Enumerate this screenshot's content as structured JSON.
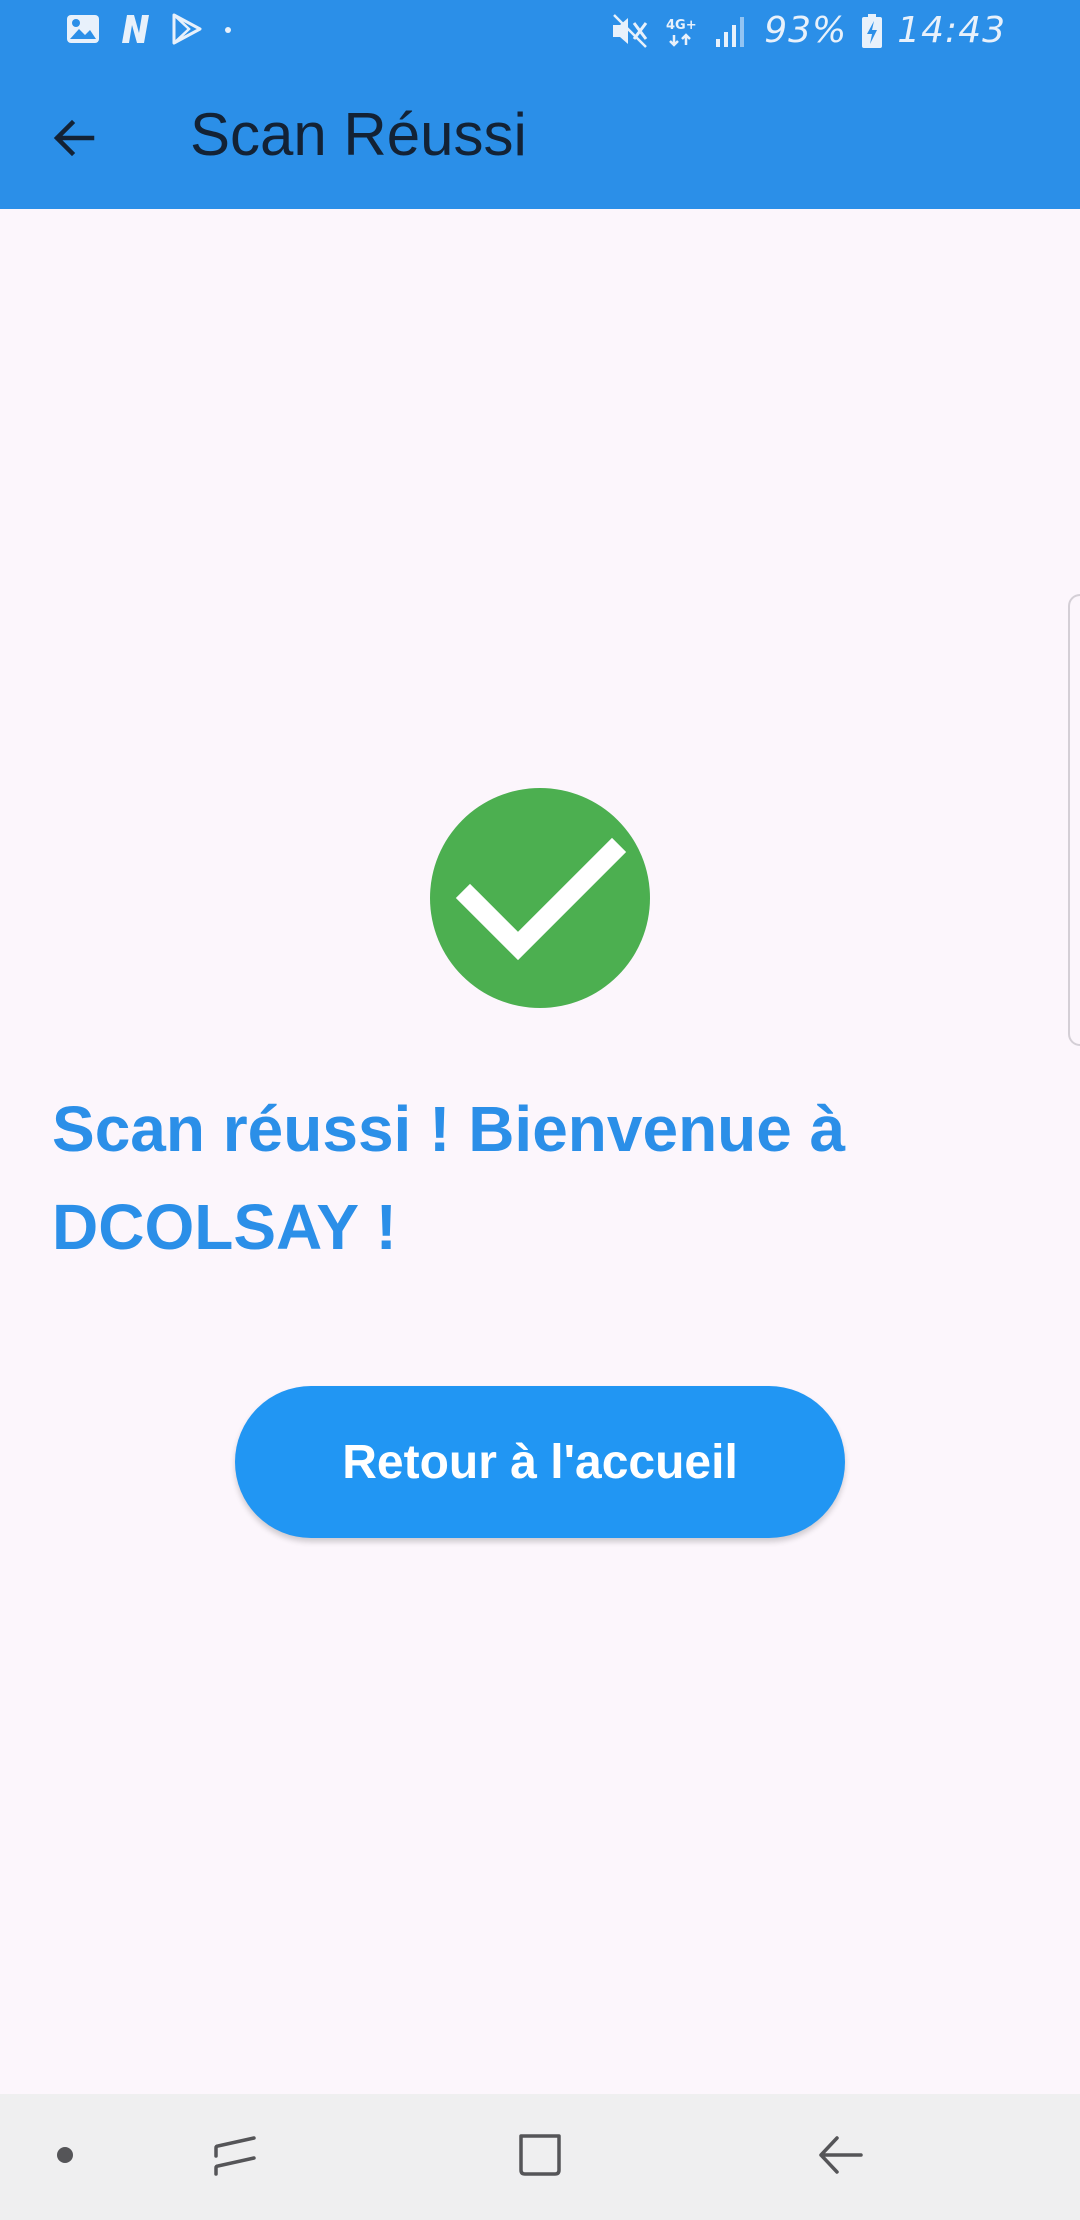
{
  "status_bar": {
    "left_icons": [
      "gallery-icon",
      "netflix-n-icon",
      "play-store-icon",
      "dot-icon"
    ],
    "right_icons": [
      "mute-icon",
      "4g-plus-icon",
      "signal-icon",
      "battery-charging-icon"
    ],
    "network": "4G+",
    "battery": "93%",
    "time": "14:43"
  },
  "app_bar": {
    "back_icon": "arrow-left-icon",
    "title": "Scan Réussi"
  },
  "main": {
    "status_icon": "check-circle-icon",
    "message": "Scan réussi ! Bienvenue à DCOLSAY !",
    "home_button_label": "Retour à l'accueil"
  },
  "nav_bar": {
    "items": [
      "dot-icon",
      "recents-icon",
      "home-icon",
      "back-icon"
    ]
  },
  "colors": {
    "primary": "#2b8fe8",
    "button": "#2196f3",
    "success": "#4caf50",
    "background": "#fcf6fc",
    "title_text": "#132235"
  }
}
